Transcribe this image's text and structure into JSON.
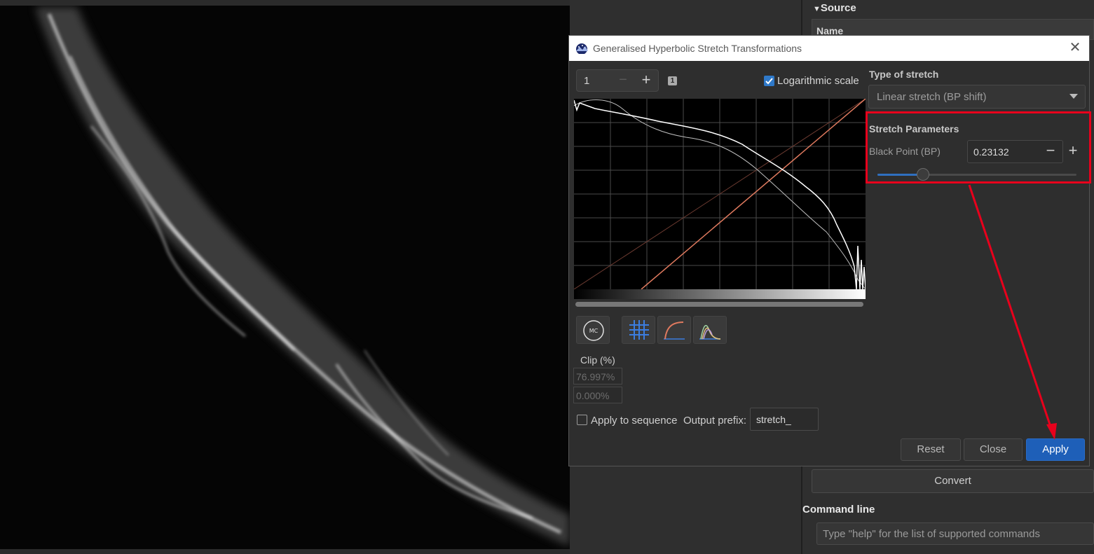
{
  "right_panel": {
    "source_header": "Source",
    "name_header": "Name",
    "convert_label": "Convert",
    "command_line_label": "Command line",
    "command_placeholder": "Type \"help\" for the list of supported commands"
  },
  "dialog": {
    "title": "Generalised Hyperbolic Stretch Transformations",
    "zoom_value": "1",
    "badge": "1",
    "log_scale_label": "Logarithmic scale",
    "log_scale_checked": true,
    "clip_label": "Clip (%)",
    "clip_low": "76.997%",
    "clip_high": "0.000%",
    "apply_sequence_label": "Apply to sequence",
    "apply_sequence_checked": false,
    "output_prefix_label": "Output prefix:",
    "output_prefix_value": "stretch_",
    "type_of_stretch_label": "Type of stretch",
    "type_of_stretch_value": "Linear stretch (BP shift)",
    "stretch_params_label": "Stretch Parameters",
    "black_point_label": "Black Point (BP)",
    "black_point_value": "0.23132",
    "black_point_slider_fraction": 0.23,
    "reset_label": "Reset",
    "close_label": "Close",
    "apply_label": "Apply",
    "tool_icons": [
      "mc-icon",
      "grid-icon",
      "curve-icon",
      "histogram-icon"
    ]
  },
  "colors": {
    "accent": "#1e5fb8",
    "highlight": "#e8001c",
    "transfer_line": "#e07a5f"
  }
}
